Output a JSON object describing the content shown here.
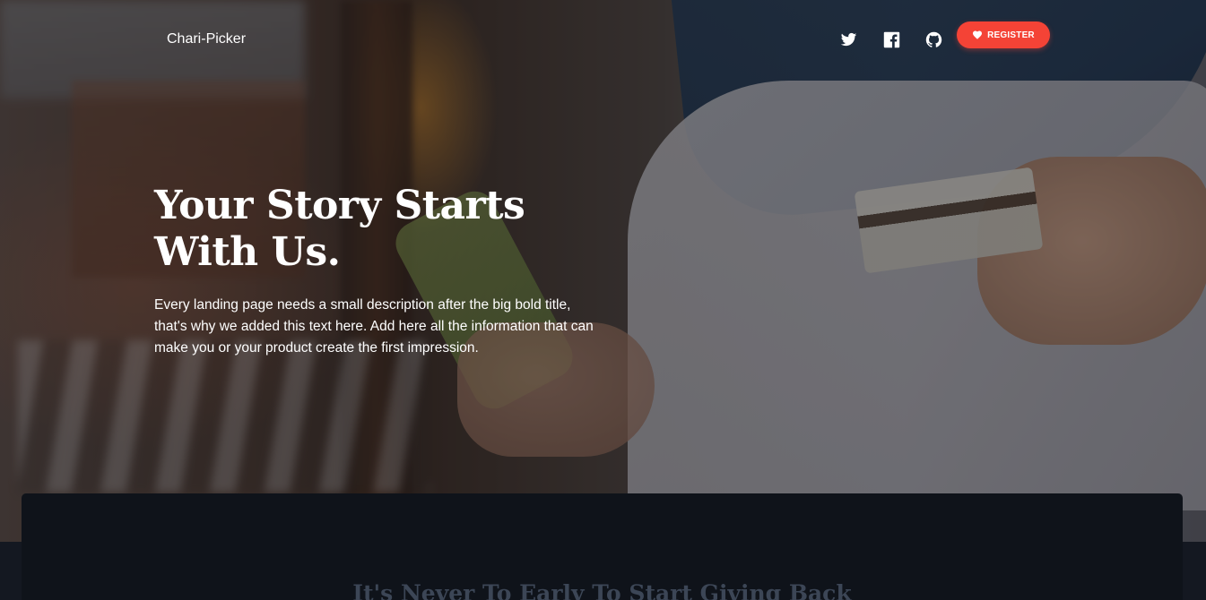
{
  "navbar": {
    "brand": "Chari-Picker",
    "social": [
      {
        "icon": "twitter-icon"
      },
      {
        "icon": "facebook-icon"
      },
      {
        "icon": "github-icon"
      }
    ],
    "register_label": "REGISTER",
    "register_icon": "heart-icon"
  },
  "hero": {
    "title": "Your Story Starts With Us.",
    "description": "Every landing page needs a small description after the big bold title, that's why we added this text here. Add here all the information that can make you or your product create the first impression."
  },
  "section": {
    "title": "It's Never To Early To Start Giving Back"
  },
  "colors": {
    "accent": "#f44336",
    "section_bg": "#0f131a",
    "section_title": "#3c4656"
  }
}
